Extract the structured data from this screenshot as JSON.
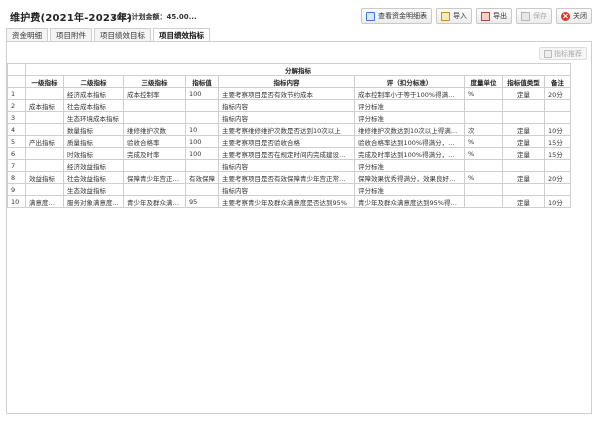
{
  "header": {
    "title": "维护费(2021年-2023年)",
    "subtitle": "2022计划金额：45.00...",
    "buttons": [
      {
        "label": "查看资金明细表",
        "icon": "view-table-icon"
      },
      {
        "label": "导入",
        "icon": "import-icon"
      },
      {
        "label": "导出",
        "icon": "export-icon"
      },
      {
        "label": "保存",
        "icon": "save-icon",
        "disabled": true
      },
      {
        "label": "关闭",
        "icon": "close-icon"
      }
    ]
  },
  "tabs": [
    {
      "label": "资金明细",
      "active": false
    },
    {
      "label": "项目附件",
      "active": false
    },
    {
      "label": "项目绩效目标",
      "active": false
    },
    {
      "label": "项目绩效指标",
      "active": true
    }
  ],
  "panel": {
    "recommend_label": "指标推荐"
  },
  "table": {
    "group_header": "分解指标",
    "columns": [
      "一级指标",
      "二级指标",
      "三级指标",
      "指标值",
      "指标内容",
      "评（扣分标准）",
      "度量单位",
      "指标值类型",
      "备注"
    ],
    "rows": [
      {
        "no": "1",
        "l1": "",
        "l2": "经济成本指标",
        "l3": "成本控制率",
        "val": "100",
        "content": "主要考察项目是否有效节约成本",
        "score": "成本控制率小于等于100%得满分，...",
        "unit": "%",
        "type": "定量",
        "note": "20分"
      },
      {
        "no": "2",
        "l1": "成本指标",
        "l2": "社会成本指标",
        "l3": "",
        "val": "",
        "content": "指标内容",
        "score": "评分标准",
        "unit": "",
        "type": "",
        "note": ""
      },
      {
        "no": "3",
        "l1": "",
        "l2": "生态环境成本指标",
        "l3": "",
        "val": "",
        "content": "指标内容",
        "score": "评分标准",
        "unit": "",
        "type": "",
        "note": ""
      },
      {
        "no": "4",
        "l1": "",
        "l2": "数量指标",
        "l3": "维修维护次数",
        "val": "10",
        "content": "主要考察维修维护次数是否达到10次以上",
        "score": "维修维护次数达到10次以上得满分...",
        "unit": "次",
        "type": "定量",
        "note": "10分"
      },
      {
        "no": "5",
        "l1": "产出指标",
        "l2": "质量指标",
        "l3": "验收合格率",
        "val": "100",
        "content": "主要考察项目是否验收合格",
        "score": "验收合格率达到100%得满分，每下...",
        "unit": "%",
        "type": "定量",
        "note": "15分"
      },
      {
        "no": "6",
        "l1": "",
        "l2": "时效指标",
        "l3": "完成及时率",
        "val": "100",
        "content": "主要考察项目是否在规定时间内完成建设与...",
        "score": "完成及时率达到100%得满分，每下...",
        "unit": "%",
        "type": "定量",
        "note": "15分"
      },
      {
        "no": "7",
        "l1": "",
        "l2": "经济效益指标",
        "l3": "",
        "val": "",
        "content": "指标内容",
        "score": "评分标准",
        "unit": "",
        "type": "",
        "note": ""
      },
      {
        "no": "8",
        "l1": "效益指标",
        "l2": "社会效益指标",
        "l3": "保障青少年宫正常...",
        "val": "有效保障",
        "content": "主要考察项目是否有效保障青少年宫正常运行",
        "score": "保障效果优秀得满分，效果良好得1...",
        "unit": "%",
        "type": "定量",
        "note": "20分"
      },
      {
        "no": "9",
        "l1": "",
        "l2": "生态效益指标",
        "l3": "",
        "val": "",
        "content": "指标内容",
        "score": "评分标准",
        "unit": "",
        "type": "",
        "note": ""
      },
      {
        "no": "10",
        "l1": "满意度指标",
        "l2": "服务对象满意度...",
        "l3": "青少年及群众满意度",
        "val": "95",
        "content": "主要考察青少年及群众满意度是否达到95%",
        "score": "青少年及群众满意度达到95%得满...",
        "unit": "",
        "type": "定量",
        "note": "10分"
      }
    ]
  }
}
